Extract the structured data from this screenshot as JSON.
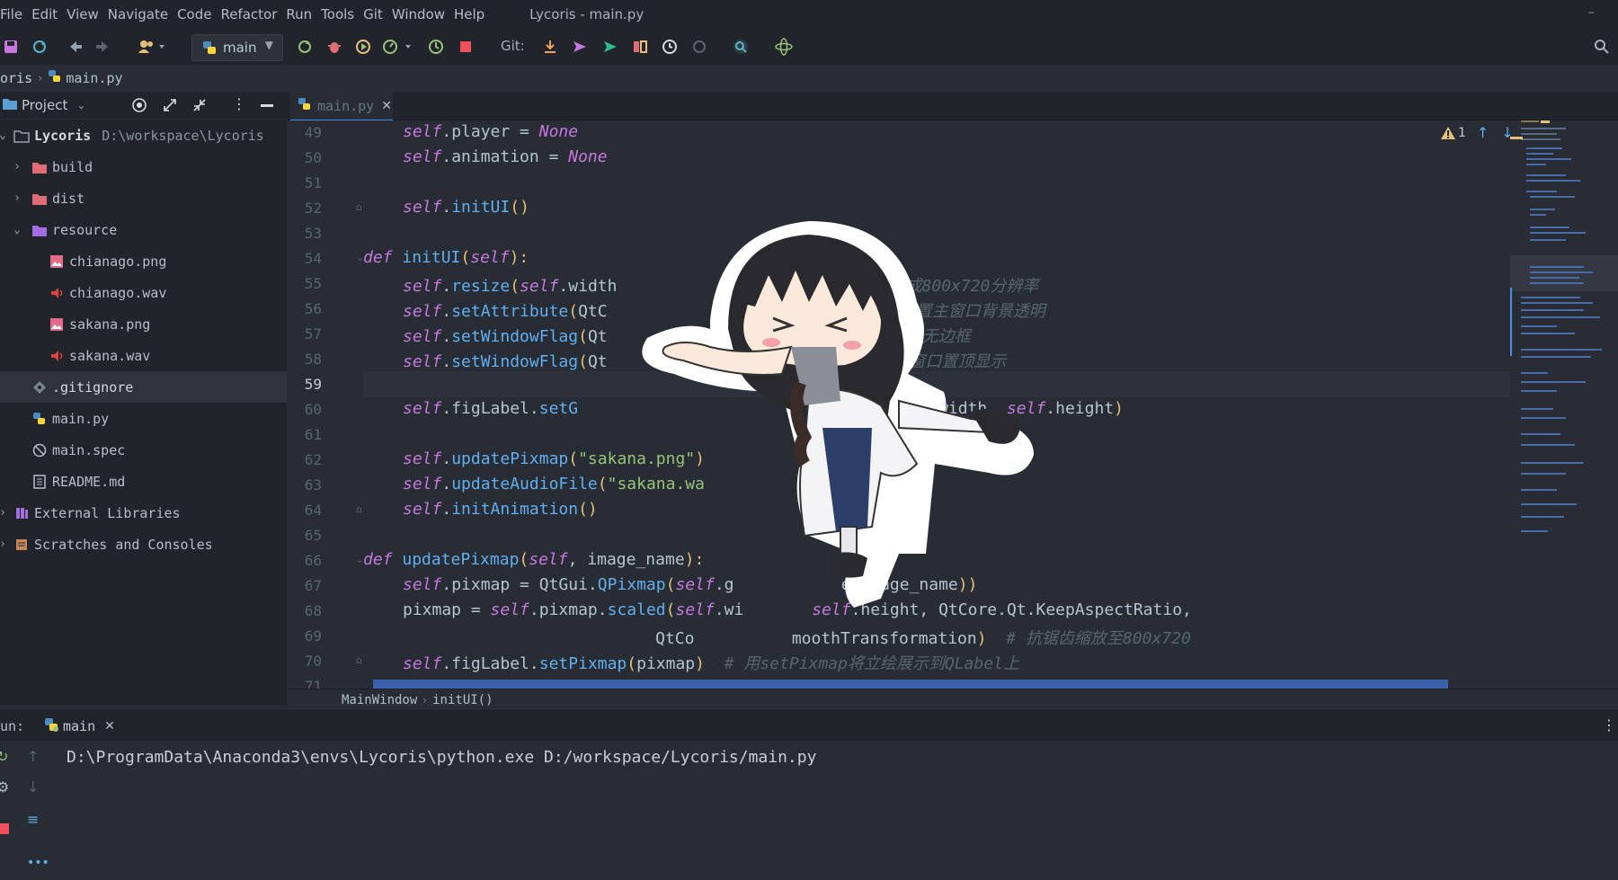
{
  "menu": [
    "File",
    "Edit",
    "View",
    "Navigate",
    "Code",
    "Refactor",
    "Run",
    "Tools",
    "Git",
    "Window",
    "Help"
  ],
  "app_title": "Lycoris - main.py",
  "toolbar": {
    "branch": "main",
    "git_label": "Git:",
    "icons": [
      "save-icon",
      "sync-icon",
      "back-icon",
      "forward-icon",
      "users-icon",
      "python-icon",
      "rerun-icon",
      "debug-icon",
      "run-coverage-icon",
      "profile-icon",
      "concurrency-icon",
      "stop-icon",
      "git-update-icon",
      "git-push-icon",
      "git-commit-icon",
      "git-compare-icon",
      "git-history-icon",
      "git-rollback-icon",
      "search-everywhere-icon",
      "plugin-icon",
      "search-icon"
    ]
  },
  "nav": {
    "project": "oris",
    "file": "main.py"
  },
  "project_panel": {
    "title": "Project",
    "tree": [
      {
        "label": "Lycoris",
        "extra": "D:\\workspace\\Lycoris",
        "icon": "folder-icon",
        "arrow": "expanded"
      },
      {
        "label": "build",
        "extra": "",
        "icon": "folder-red-icon",
        "arrow": "collapsed"
      },
      {
        "label": "dist",
        "extra": "",
        "icon": "folder-red-icon",
        "arrow": "collapsed"
      },
      {
        "label": "resource",
        "extra": "",
        "icon": "folder-purple-icon",
        "arrow": "expanded"
      },
      {
        "label": "chianago.png",
        "extra": "",
        "icon": "image-file-icon",
        "arrow": ""
      },
      {
        "label": "chianago.wav",
        "extra": "",
        "icon": "audio-file-icon",
        "arrow": ""
      },
      {
        "label": "sakana.png",
        "extra": "",
        "icon": "image-file-icon",
        "arrow": ""
      },
      {
        "label": "sakana.wav",
        "extra": "",
        "icon": "audio-file-icon",
        "arrow": ""
      },
      {
        "label": ".gitignore",
        "extra": "",
        "icon": "gitignore-icon",
        "arrow": ""
      },
      {
        "label": "main.py",
        "extra": "",
        "icon": "python-file-icon",
        "arrow": ""
      },
      {
        "label": "main.spec",
        "extra": "",
        "icon": "spec-file-icon",
        "arrow": ""
      },
      {
        "label": "README.md",
        "extra": "",
        "icon": "markdown-file-icon",
        "arrow": ""
      },
      {
        "label": "External Libraries",
        "extra": "",
        "icon": "library-icon",
        "arrow": "collapsed"
      },
      {
        "label": "Scratches and Consoles",
        "extra": "",
        "icon": "scratches-icon",
        "arrow": "collapsed"
      }
    ]
  },
  "editor": {
    "tab": "main.py",
    "line_numbers": [
      "49",
      "50",
      "51",
      "52",
      "53",
      "54",
      "55",
      "56",
      "57",
      "58",
      "59",
      "60",
      "61",
      "62",
      "63",
      "64",
      "65",
      "66",
      "67",
      "68",
      "69",
      "70",
      "71"
    ],
    "current_line": "59",
    "inspection": "1",
    "lines": [
      {
        "indent": 2,
        "tokens": [
          {
            "t": "self",
            "c": "sf"
          },
          {
            "t": ".player = ",
            "c": ""
          },
          {
            "t": "None",
            "c": "kw"
          }
        ]
      },
      {
        "indent": 2,
        "tokens": [
          {
            "t": "self",
            "c": "sf"
          },
          {
            "t": ".animation = ",
            "c": ""
          },
          {
            "t": "None",
            "c": "kw"
          }
        ]
      },
      {
        "indent": 0,
        "tokens": []
      },
      {
        "indent": 2,
        "tokens": [
          {
            "t": "self",
            "c": "sf"
          },
          {
            "t": ".",
            "c": ""
          },
          {
            "t": "initUI",
            "c": "fn"
          },
          {
            "t": "()",
            "c": "pu"
          }
        ]
      },
      {
        "indent": 0,
        "tokens": []
      },
      {
        "indent": 1,
        "tokens": [
          {
            "t": "def ",
            "c": "kw"
          },
          {
            "t": "initUI",
            "c": "fn"
          },
          {
            "t": "(",
            "c": "pu"
          },
          {
            "t": "self",
            "c": "sf"
          },
          {
            "t": "):",
            "c": "pu"
          }
        ]
      },
      {
        "indent": 2,
        "tokens": [
          {
            "t": "self",
            "c": "sf"
          },
          {
            "t": ".",
            "c": ""
          },
          {
            "t": "resize",
            "c": "fn"
          },
          {
            "t": "(",
            "c": "pu"
          },
          {
            "t": "self",
            "c": "sf"
          },
          {
            "t": ".width                ",
            "c": ""
          },
          {
            "t": "# 将窗口大小缩放成800x720分辨率",
            "c": "cm"
          }
        ]
      },
      {
        "indent": 2,
        "tokens": [
          {
            "t": "self",
            "c": "sf"
          },
          {
            "t": ".",
            "c": ""
          },
          {
            "t": "setAttribute",
            "c": "fn"
          },
          {
            "t": "(",
            "c": "pu"
          },
          {
            "t": "QtC",
            "c": ""
          },
          {
            "t": "                  kground",
            "c": ""
          },
          {
            "t": ")  ",
            "c": "pu"
          },
          {
            "t": "# 设置主窗口背景透明",
            "c": "cm"
          }
        ]
      },
      {
        "indent": 2,
        "tokens": [
          {
            "t": "self",
            "c": "sf"
          },
          {
            "t": ".",
            "c": ""
          },
          {
            "t": "setWindowFlag",
            "c": "fn"
          },
          {
            "t": "(",
            "c": "pu"
          },
          {
            "t": "Qt",
            "c": ""
          },
          {
            "t": "                int",
            "c": ""
          },
          {
            "t": ")  ",
            "c": "pu"
          },
          {
            "t": "# 设置主窗口无边框",
            "c": "cm"
          }
        ]
      },
      {
        "indent": 2,
        "tokens": [
          {
            "t": "self",
            "c": "sf"
          },
          {
            "t": ".",
            "c": ""
          },
          {
            "t": "setWindowFlag",
            "c": "fn"
          },
          {
            "t": "(",
            "c": "pu"
          },
          {
            "t": "Qt",
            "c": ""
          },
          {
            "t": "                 Hint",
            "c": ""
          },
          {
            "t": ")  ",
            "c": "pu"
          },
          {
            "t": "# 设置主窗口置顶显示",
            "c": "cm"
          }
        ]
      },
      {
        "indent": 0,
        "tokens": []
      },
      {
        "indent": 2,
        "tokens": [
          {
            "t": "self",
            "c": "sf"
          },
          {
            "t": ".figLabel.",
            "c": ""
          },
          {
            "t": "setG",
            "c": "fn"
          },
          {
            "t": "                        height, ",
            "c": ""
          },
          {
            "t": "self",
            "c": "sf"
          },
          {
            "t": ".width, ",
            "c": ""
          },
          {
            "t": "self",
            "c": "sf"
          },
          {
            "t": ".height",
            "c": ""
          },
          {
            "t": ")",
            "c": "pu"
          }
        ]
      },
      {
        "indent": 0,
        "tokens": []
      },
      {
        "indent": 2,
        "tokens": [
          {
            "t": "self",
            "c": "sf"
          },
          {
            "t": ".",
            "c": ""
          },
          {
            "t": "updatePixmap",
            "c": "fn"
          },
          {
            "t": "(",
            "c": "pu"
          },
          {
            "t": "\"sakana.png\"",
            "c": "st"
          },
          {
            "t": ")",
            "c": "pu"
          }
        ]
      },
      {
        "indent": 2,
        "tokens": [
          {
            "t": "self",
            "c": "sf"
          },
          {
            "t": ".",
            "c": ""
          },
          {
            "t": "updateAudioFile",
            "c": "fn"
          },
          {
            "t": "(",
            "c": "pu"
          },
          {
            "t": "\"sakana.wa",
            "c": "st"
          }
        ]
      },
      {
        "indent": 2,
        "tokens": [
          {
            "t": "self",
            "c": "sf"
          },
          {
            "t": ".",
            "c": ""
          },
          {
            "t": "initAnimation",
            "c": "fn"
          },
          {
            "t": "()",
            "c": "pu"
          }
        ]
      },
      {
        "indent": 0,
        "tokens": []
      },
      {
        "indent": 1,
        "tokens": [
          {
            "t": "def ",
            "c": "kw"
          },
          {
            "t": "updatePixmap",
            "c": "fn"
          },
          {
            "t": "(",
            "c": "pu"
          },
          {
            "t": "self",
            "c": "sf"
          },
          {
            "t": ", image_name",
            "c": ""
          },
          {
            "t": "):",
            "c": "pu"
          }
        ]
      },
      {
        "indent": 2,
        "tokens": [
          {
            "t": "self",
            "c": "sf"
          },
          {
            "t": ".pixmap = QtGui.",
            "c": ""
          },
          {
            "t": "QPixmap",
            "c": "fn"
          },
          {
            "t": "(",
            "c": "pu"
          },
          {
            "t": "self",
            "c": "sf"
          },
          {
            "t": ".g",
            "c": ""
          },
          {
            "t": "           e",
            "c": ""
          },
          {
            "t": "(",
            "c": "pu"
          },
          {
            "t": "image_name",
            "c": ""
          },
          {
            "t": "))",
            "c": "pu"
          }
        ]
      },
      {
        "indent": 2,
        "tokens": [
          {
            "t": "pixmap = ",
            "c": ""
          },
          {
            "t": "self",
            "c": "sf"
          },
          {
            "t": ".pixmap.",
            "c": ""
          },
          {
            "t": "scaled",
            "c": "fn"
          },
          {
            "t": "(",
            "c": "pu"
          },
          {
            "t": "self",
            "c": "sf"
          },
          {
            "t": ".wi       ",
            "c": ""
          },
          {
            "t": "self",
            "c": "sf"
          },
          {
            "t": ".height, QtCore.Qt.KeepAspectRatio,",
            "c": ""
          }
        ]
      },
      {
        "indent": 0,
        "tokens": [
          {
            "t": "                              QtCo          moothTransformation",
            "c": ""
          },
          {
            "t": ")  ",
            "c": "pu"
          },
          {
            "t": "# 抗锯齿缩放至800x720",
            "c": "cm"
          }
        ]
      },
      {
        "indent": 2,
        "tokens": [
          {
            "t": "self",
            "c": "sf"
          },
          {
            "t": ".figLabel.",
            "c": ""
          },
          {
            "t": "setPixmap",
            "c": "fn"
          },
          {
            "t": "(",
            "c": "pu"
          },
          {
            "t": "pixmap",
            "c": ""
          },
          {
            "t": ")  ",
            "c": "pu"
          },
          {
            "t": "# 用setPixmap将立绘展示到QLabel上",
            "c": "cm"
          }
        ]
      }
    ],
    "breadcrumb": [
      "MainWindow",
      "initUI()"
    ]
  },
  "run": {
    "label": "un:",
    "tab": "main",
    "output": "D:\\ProgramData\\Anaconda3\\envs\\Lycoris\\python.exe D:/workspace/Lycoris/main.py"
  },
  "colors": {
    "accent": "#4d8de8",
    "background": "#282c34",
    "panel": "#21252b"
  }
}
